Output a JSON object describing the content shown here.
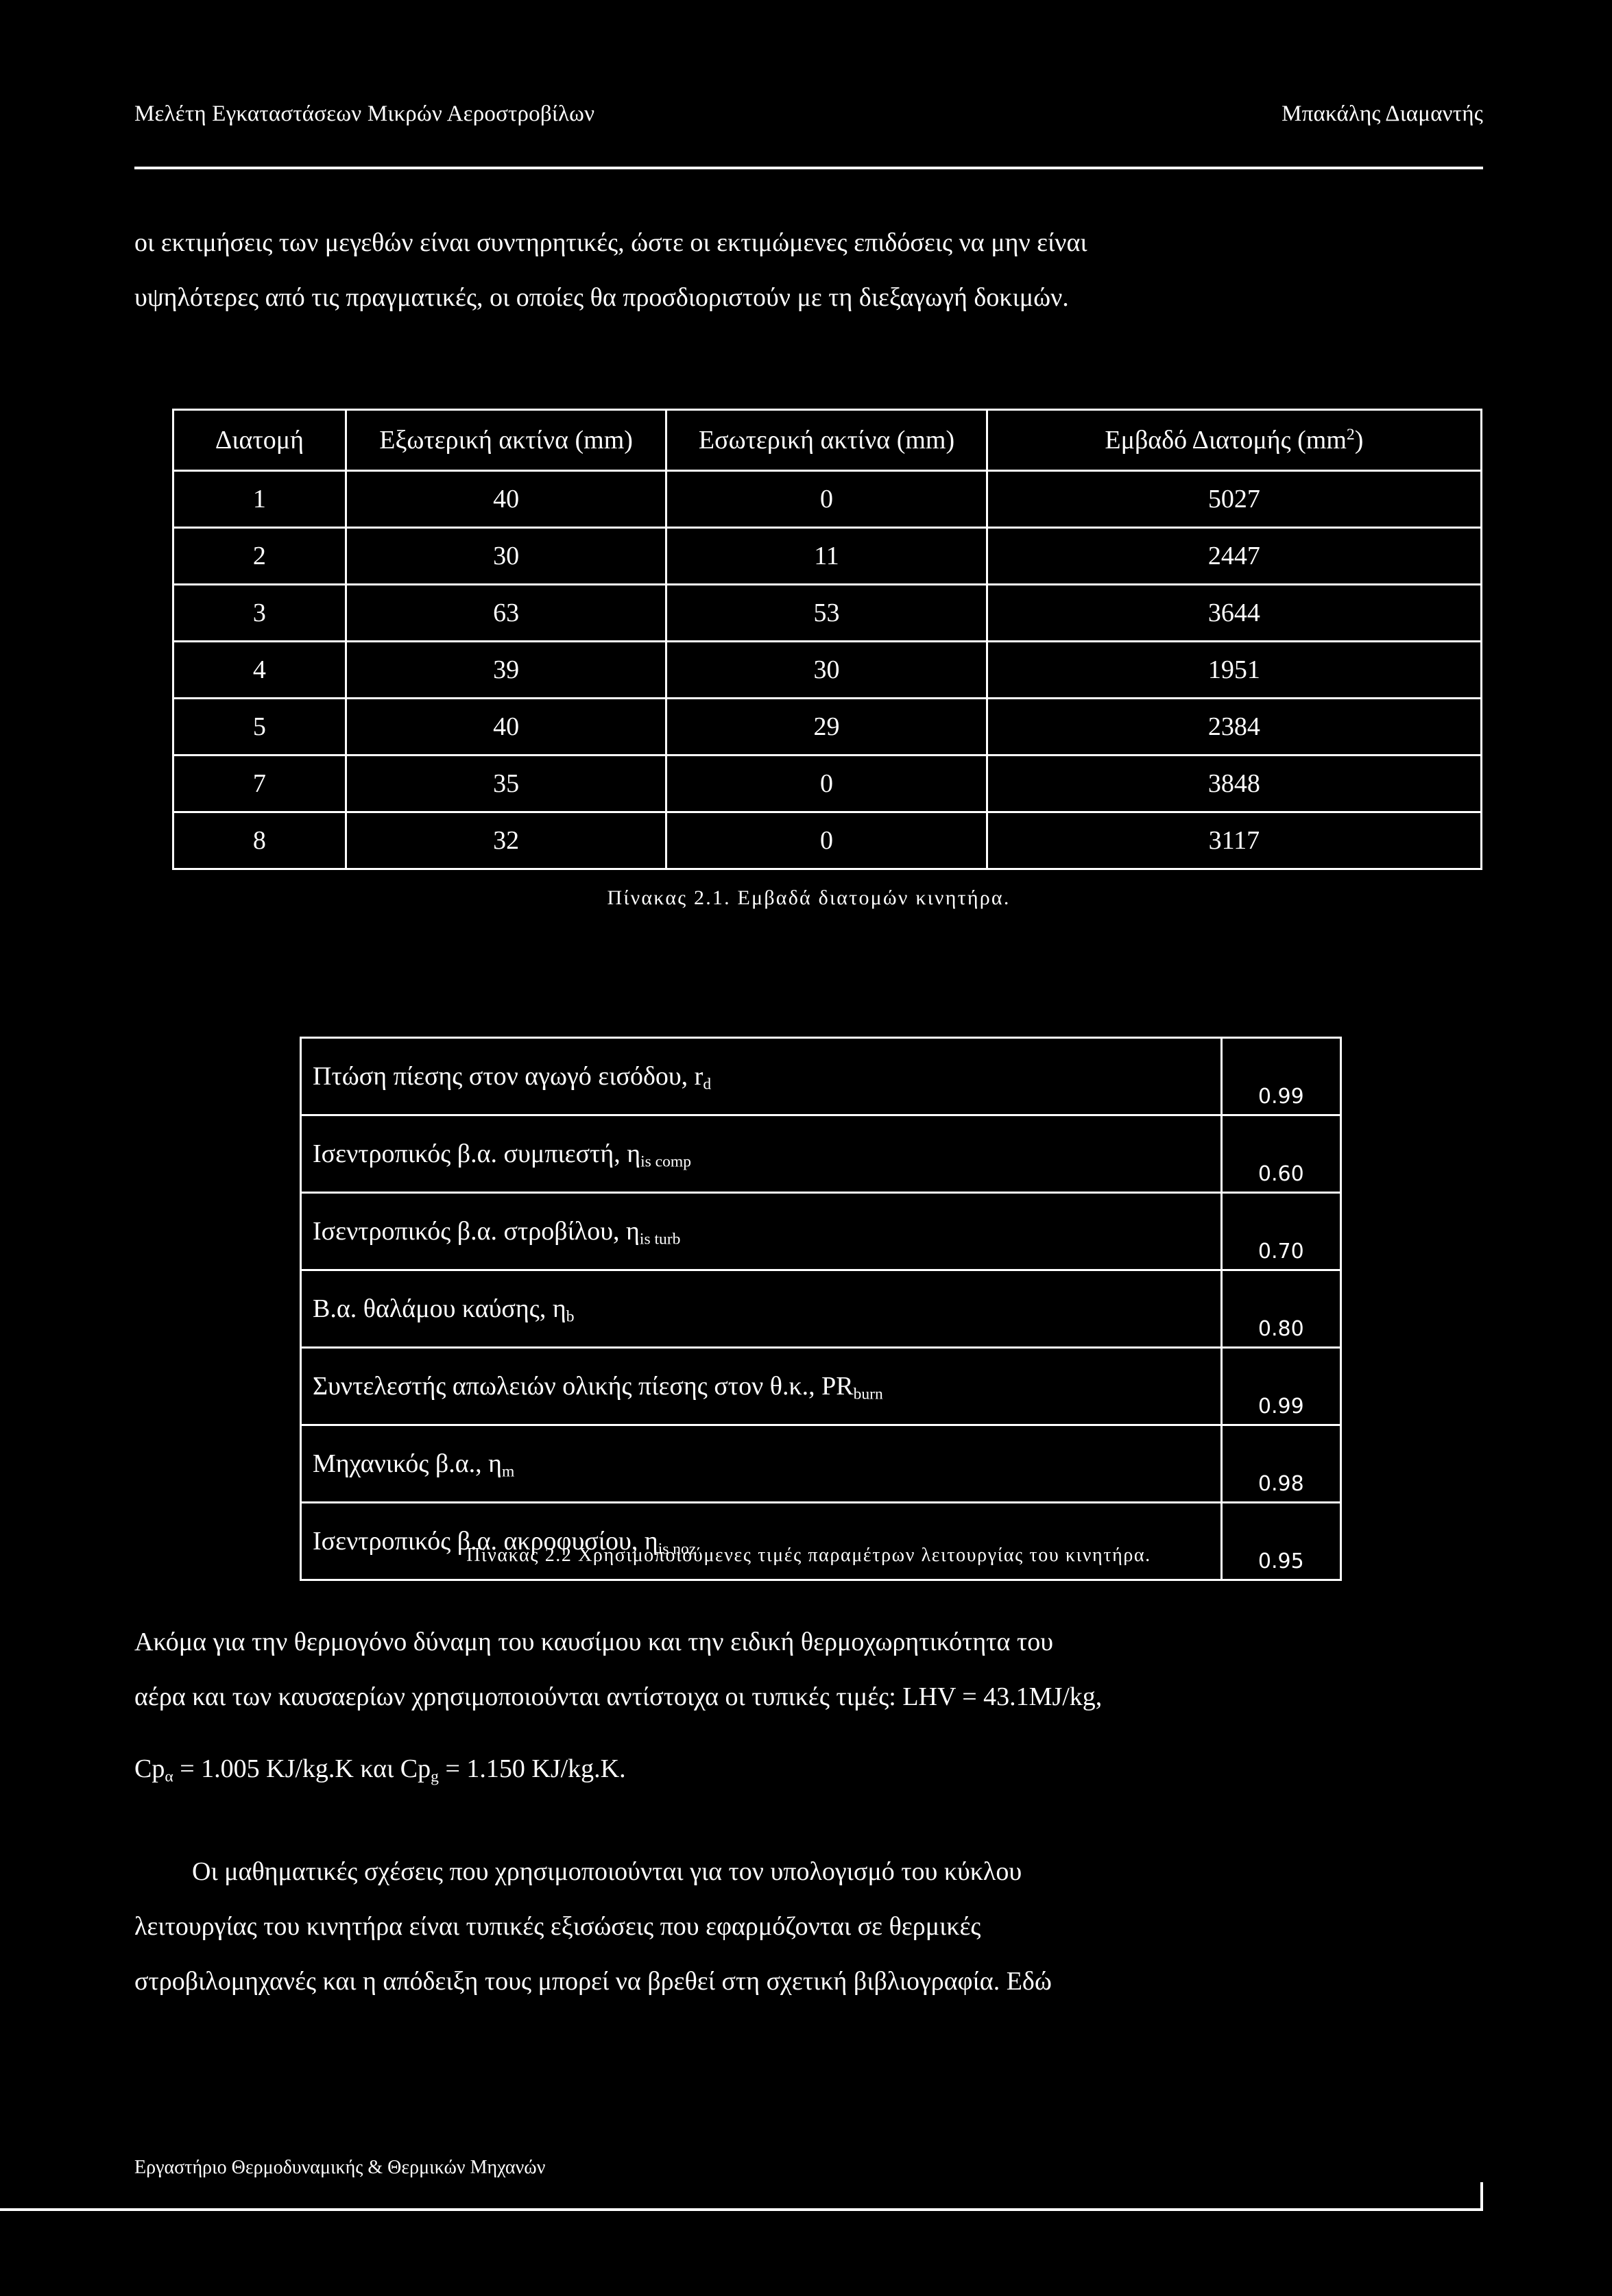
{
  "header": {
    "left_title": "Μελέτη Εγκαταστάσεων Μικρών Αεροστροβίλων",
    "right_author": "Μπακάλης Διαμαντής"
  },
  "intro_paragraph": {
    "line1": "οι εκτιμήσεις των μεγεθών είναι συντηρητικές, ώστε οι εκτιμώμενες επιδόσεις να μην είναι",
    "line2": "υψηλότερες από τις πραγματικές, οι οποίες θα προσδιοριστούν με τη διεξαγωγή δοκιμών."
  },
  "table_sections": {
    "headers": [
      "Διατομή",
      "Εξωτερική ακτίνα (mm)",
      "Εσωτερική ακτίνα (mm)",
      "Εμβαδό Διατομής (mm",
      "2",
      ")"
    ],
    "header_plain": [
      "Διατομή",
      "Εξωτερική ακτίνα (mm)",
      "Εσωτερική ακτίνα (mm)",
      "Εμβαδό Διατομής (mm²)"
    ],
    "rows": [
      [
        "1",
        "40",
        "0",
        "5027"
      ],
      [
        "2",
        "30",
        "11",
        "2447"
      ],
      [
        "3",
        "63",
        "53",
        "3644"
      ],
      [
        "4",
        "39",
        "30",
        "1951"
      ],
      [
        "5",
        "40",
        "29",
        "2384"
      ],
      [
        "7",
        "35",
        "0",
        "3848"
      ],
      [
        "8",
        "32",
        "0",
        "3117"
      ]
    ],
    "caption": "Πίνακας 2.1. Εμβαδά διατομών κινητήρα."
  },
  "table_params": {
    "rows": [
      {
        "label_pre": "Πτώση πίεσης στον αγωγό εισόδου, r",
        "label_sub": "d",
        "label_post": "",
        "value": "0.99"
      },
      {
        "label_pre": "Ισεντροπικός β.α. συμπιεστή, η",
        "label_sub": "is comp",
        "label_post": "",
        "value": "0.60"
      },
      {
        "label_pre": "Ισεντροπικός β.α. στροβίλου, η",
        "label_sub": "is turb",
        "label_post": "",
        "value": "0.70"
      },
      {
        "label_pre": "Β.α. θαλάμου καύσης, η",
        "label_sub": "b",
        "label_post": "",
        "value": "0.80"
      },
      {
        "label_pre": "Συντελεστής απωλειών ολικής πίεσης στον θ.κ., PR",
        "label_sub": "burn",
        "label_post": "",
        "value": "0.99"
      },
      {
        "label_pre": "Μηχανικός β.α., η",
        "label_sub": "m",
        "label_post": "",
        "value": "0.98"
      },
      {
        "label_pre": "Ισεντροπικός β.α. ακροφυσίου, η",
        "label_sub": "is noz",
        "label_post": "",
        "value": "0.95"
      }
    ],
    "caption": "Πίνακας 2.2 Χρησιμοποιούμενες τιμές παραμέτρων λειτουργίας του κινητήρα."
  },
  "body": {
    "fuel_para_line1": "Ακόμα για την θερμογόνο δύναμη του καυσίμου και την ειδική θερμοχωρητικότητα του",
    "fuel_para_line2": "αέρα και των καυσαερίων χρησιμοποιούνται αντίστοιχα οι τυπικές τιμές: LHV = 43.1MJ/kg,",
    "cp_pre": "Cp",
    "cp_sub_a": "α",
    "cp_mid": " = 1.005 KJ/kg.K και Cp",
    "cp_sub_g": "g",
    "cp_post": " = 1.150 KJ/kg.K.",
    "eq_para_line1": "Οι μαθηματικές σχέσεις που χρησιμοποιούνται για τον υπολογισμό του κύκλου",
    "eq_para_line2": "λειτουργίας του κινητήρα είναι τυπικές εξισώσεις που εφαρμόζονται σε θερμικές",
    "eq_para_line3": "στροβιλομηχανές και η απόδειξη τους μπορεί να βρεθεί στη σχετική βιβλιογραφία. Εδώ"
  },
  "footer": {
    "lab": "Εργαστήριο Θερμοδυναμικής & Θερμικών Μηχανών"
  },
  "colors": {
    "background": "#000000",
    "foreground": "#ffffff"
  }
}
